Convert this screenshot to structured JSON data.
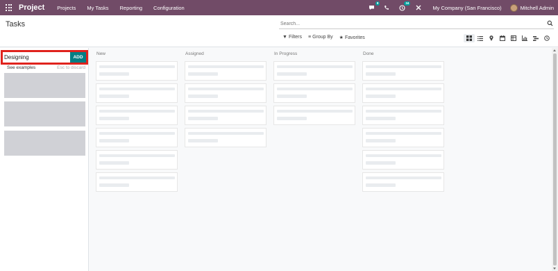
{
  "navbar": {
    "brand": "Project",
    "menu": [
      "Projects",
      "My Tasks",
      "Reporting",
      "Configuration"
    ],
    "messages_badge": "8",
    "activity_badge": "34",
    "company": "My Company (San Francisco)",
    "user": "Mitchell Admin"
  },
  "page": {
    "title": "Tasks"
  },
  "search": {
    "placeholder": "Search..."
  },
  "filters": {
    "filters_label": "Filters",
    "groupby_label": "Group By",
    "favorites_label": "Favorites"
  },
  "views": [
    "kanban",
    "list",
    "map",
    "calendar",
    "pivot",
    "graph",
    "gantt",
    "activity"
  ],
  "quick_create": {
    "value": "Designing",
    "add_label": "ADD",
    "see_examples": "See examples",
    "esc_discard": "Esc to discard"
  },
  "columns": [
    {
      "title": "New",
      "card_count": 6
    },
    {
      "title": "Assigned",
      "card_count": 4
    },
    {
      "title": "In Progress",
      "card_count": 3
    },
    {
      "title": "Done",
      "card_count": 6
    }
  ],
  "colors": {
    "navbar": "#714b67",
    "add_button": "#017e84",
    "highlight": "#e0231d"
  }
}
